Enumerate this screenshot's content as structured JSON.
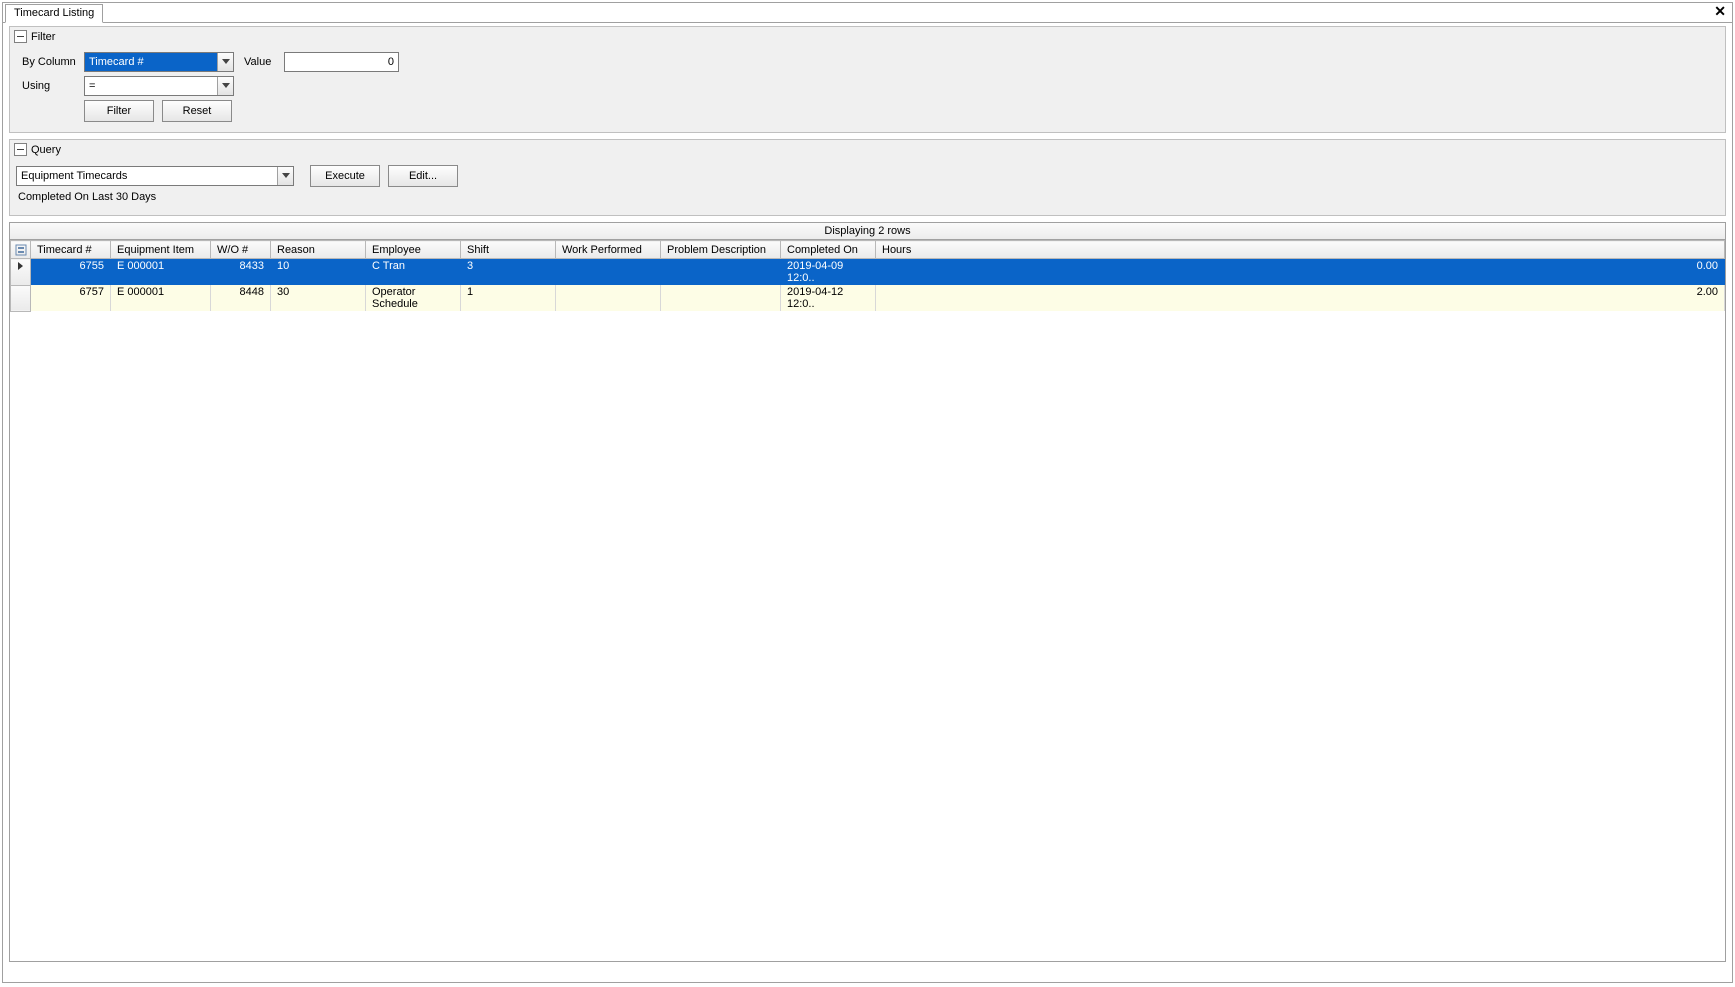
{
  "tab_title": "Timecard Listing",
  "close_glyph": "✕",
  "filter": {
    "title": "Filter",
    "by_column_label": "By Column",
    "by_column_value": "Timecard #",
    "using_label": "Using",
    "using_value": "=",
    "value_label": "Value",
    "value_value": "0",
    "filter_btn": "Filter",
    "reset_btn": "Reset"
  },
  "query": {
    "title": "Query",
    "selected": "Equipment Timecards",
    "execute_btn": "Execute",
    "edit_btn": "Edit...",
    "description": "Completed On Last 30 Days"
  },
  "grid": {
    "caption": "Displaying 2 rows",
    "columns": [
      "Timecard #",
      "Equipment Item",
      "W/O #",
      "Reason",
      "Employee",
      "Shift",
      "Work Performed",
      "Problem Description",
      "Completed On",
      "Hours"
    ],
    "rows": [
      {
        "selected": true,
        "timecard": "6755",
        "equipment": "E 000001",
        "wo": "8433",
        "reason": "10",
        "employee": "C Tran",
        "shift": "3",
        "work": "",
        "problem": "",
        "completed": "2019-04-09  12:0..",
        "hours": "0.00"
      },
      {
        "selected": false,
        "timecard": "6757",
        "equipment": "E 000001",
        "wo": "8448",
        "reason": "30",
        "employee": "Operator Schedule",
        "shift": "1",
        "work": "",
        "problem": "",
        "completed": "2019-04-12  12:0..",
        "hours": "2.00"
      }
    ]
  }
}
